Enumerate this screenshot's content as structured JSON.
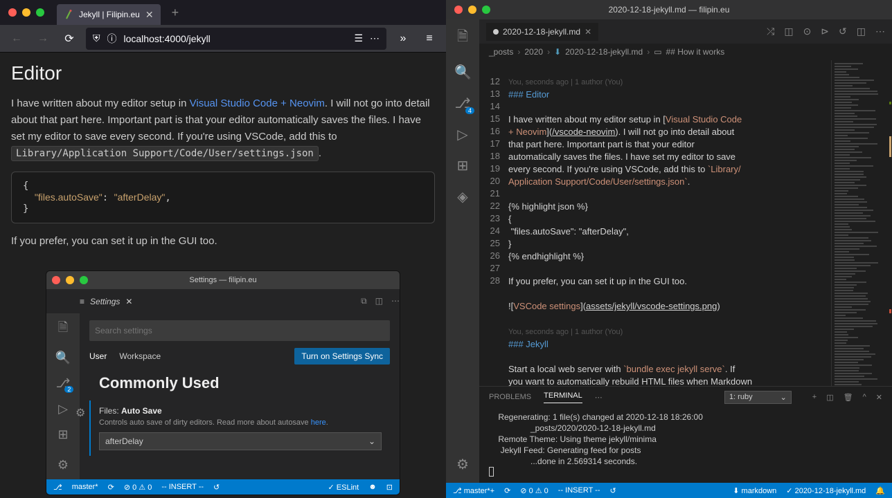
{
  "browser": {
    "tab_title": "Jekyll | Filipin.eu",
    "url": "localhost:4000/jekyll",
    "article": {
      "heading": "Editor",
      "p1_a": "I have written about my editor setup in ",
      "link1": "Visual Studio Code + Neovim",
      "p1_b": ". I will not go into detail about that part here. Important part is that your editor automatically saves the files. I have set my editor to save every second. If you're using VSCode, add this to ",
      "inline_code": "Library/Application Support/Code/User/settings.json",
      "p1_c": ".",
      "code": "{\n  \"files.autoSave\": \"afterDelay\",\n}",
      "p2": "If you prefer, you can set it up in the GUI too."
    },
    "nested": {
      "title": "Settings — filipin.eu",
      "tab": "Settings",
      "search_placeholder": "Search settings",
      "tab_user": "User",
      "tab_workspace": "Workspace",
      "sync": "Turn on Settings Sync",
      "section": "Commonly Used",
      "setting_label_a": "Files: ",
      "setting_label_b": "Auto Save",
      "setting_desc_a": "Controls auto save of dirty editors. Read more about autosave ",
      "setting_desc_link": "here",
      "setting_desc_b": ".",
      "select_value": "afterDelay",
      "status": {
        "branch": "master*",
        "errors": "0",
        "warnings": "0",
        "mode": "-- INSERT --",
        "eslint": "ESLint",
        "scm_badge": "2"
      }
    }
  },
  "vscode": {
    "title": "2020-12-18-jekyll.md — filipin.eu",
    "tab": "2020-12-18-jekyll.md",
    "breadcrumb": {
      "a": "_posts",
      "b": "2020",
      "c": "2020-12-18-jekyll.md",
      "d": "## How it works"
    },
    "blame1": "You, seconds ago | 1 author (You)",
    "lines": {
      "l12": "### Editor",
      "l14": "I have written about my editor setup in [Visual Studio Code + Neovim](/vscode-neovim). I will not go into detail about that part here. Important part is that your editor automatically saves the files. I have set my editor to save every second. If you're using VSCode, add this to `Library/Application Support/Code/User/settings.json`.",
      "l16": "{% highlight json %}",
      "l17": "{",
      "l18": " \"files.autoSave\": \"afterDelay\",",
      "l19": "}",
      "l20": "{% endhighlight %}",
      "l22": "If you prefer, you can set it up in the GUI too.",
      "l24_a": "![",
      "l24_b": "VSCode settings",
      "l24_c": "](",
      "l24_d": "assets/jekyll/vscode-settings.png",
      "l24_e": ")",
      "l26": "### Jekyll",
      "l28": "Start a local web server with `bundle exec jekyll serve`. If you want to automatically rebuild HTML files when Markdown"
    },
    "line_numbers": [
      "12",
      "13",
      "14",
      "",
      "",
      "",
      "",
      "",
      "15",
      "16",
      "17",
      "18",
      "19",
      "20",
      "21",
      "22",
      "23",
      "24",
      "25",
      "",
      "26",
      "27",
      "28",
      ""
    ],
    "panel": {
      "tab_problems": "PROBLEMS",
      "tab_terminal": "TERMINAL",
      "select": "1: ruby",
      "output": "    Regenerating: 1 file(s) changed at 2020-12-18 18:26:00\n                  _posts/2020/2020-12-18-jekyll.md\n    Remote Theme: Using theme jekyll/minima\n     Jekyll Feed: Generating feed for posts\n                  ...done in 2.569314 seconds.\n"
    },
    "status": {
      "branch": "master*+",
      "errors": "0",
      "warnings": "0",
      "mode": "-- INSERT --",
      "lang": "markdown",
      "file": "2020-12-18-jekyll.md",
      "scm_badge": "4"
    }
  }
}
